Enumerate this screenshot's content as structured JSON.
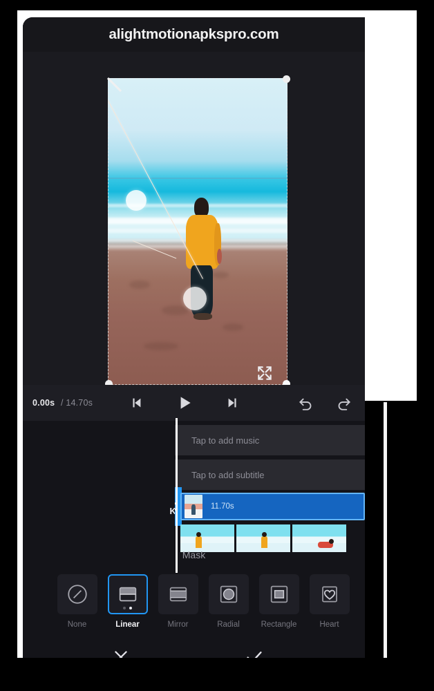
{
  "watermark": {
    "text": "alightmotionapkspro.com"
  },
  "player": {
    "current_time": "0.00s",
    "total_time": "/ 14.70s",
    "icons": {
      "skip_back": "skip-previous-icon",
      "play": "play-icon",
      "skip_forward": "skip-next-icon",
      "undo": "undo-icon",
      "redo": "redo-icon",
      "expand": "expand-fullscreen-icon"
    }
  },
  "editor": {
    "keyframe_label": "Keyframe",
    "keyframe_icon": "diamond-plus-icon",
    "section_title": "Mask"
  },
  "timeline": {
    "music_track": "Tap to add music",
    "subtitle_track": "Tap to add subtitle",
    "clip_duration": "11.70s",
    "grab_icon": "chevron-left-icon"
  },
  "masks": {
    "options": [
      {
        "label": "None",
        "icon": "circle-slash-icon",
        "selected": false
      },
      {
        "label": "Linear",
        "icon": "linear-mask-icon",
        "selected": true
      },
      {
        "label": "Mirror",
        "icon": "mirror-mask-icon",
        "selected": false
      },
      {
        "label": "Radial",
        "icon": "radial-mask-icon",
        "selected": false
      },
      {
        "label": "Rectangle",
        "icon": "rectangle-mask-icon",
        "selected": false
      },
      {
        "label": "Heart",
        "icon": "heart-mask-icon",
        "selected": false
      }
    ],
    "page_dots": {
      "count": 2,
      "active_index": 1
    }
  },
  "bottom_bar": {
    "cancel_icon": "close-x-icon",
    "confirm_icon": "check-icon"
  },
  "colors": {
    "accent_blue": "#2196f3",
    "clip_blue": "#1565c0",
    "panel_dark": "#141419",
    "bar_dark": "#1e1e24",
    "track_gray": "#2a2a30",
    "text_muted": "#8d8d96",
    "text_bright": "#f2f2f5",
    "frame_white": "#ffffff"
  }
}
